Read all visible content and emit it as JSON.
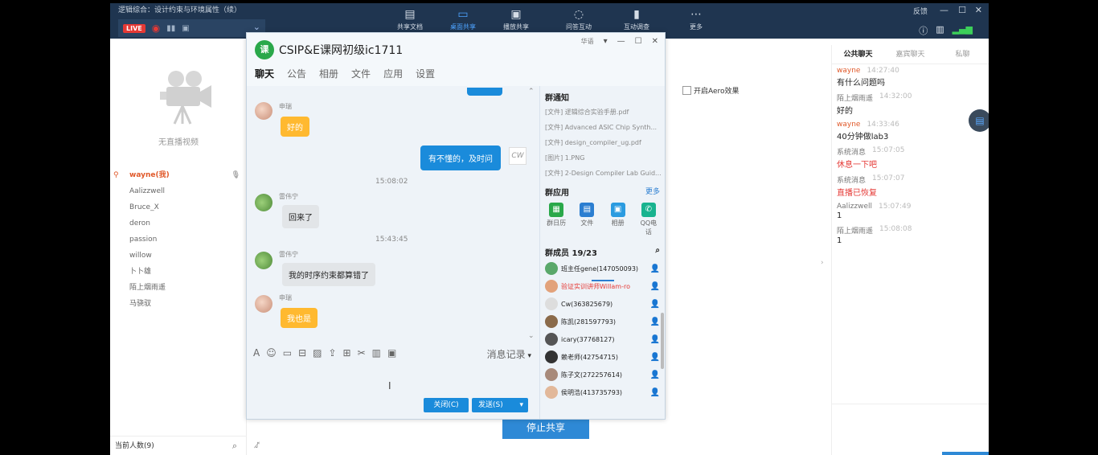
{
  "app": {
    "title": "逻辑综合：设计约束与环境属性（续）",
    "feedback": "反馈",
    "live_label": "LIVE",
    "toolbar": [
      {
        "label": "共享文档",
        "icon": "▤",
        "active": false
      },
      {
        "label": "桌面共享",
        "icon": "▭",
        "active": true
      },
      {
        "label": "播放共享",
        "icon": "▣",
        "active": false
      },
      {
        "label": "问答互动",
        "icon": "◌",
        "active": false
      },
      {
        "label": "互动调查",
        "icon": "▮",
        "active": false
      },
      {
        "label": "更多",
        "icon": "⋯",
        "active": false
      }
    ]
  },
  "left": {
    "no_video": "无直播视频",
    "me": "wayne(我)",
    "members": [
      "Aalizzwell",
      "Bruce_X",
      "deron",
      "passion",
      "willow",
      "卜卜雄",
      "陌上烟雨遥",
      "马骁驭"
    ],
    "count_label": "当前人数(9)"
  },
  "aero_label": "开启Aero效果",
  "stop_share": "停止共享",
  "qq": {
    "title": "CSIP&E课网初级ic1711",
    "lang": "华语",
    "tabs": [
      "聊天",
      "公告",
      "相册",
      "文件",
      "应用",
      "设置"
    ],
    "messages": {
      "m1_sender": "申瑞",
      "m1_text": "好的",
      "m2_text": "有不懂的，及时问",
      "my_avatar": "CW",
      "ts1": "15:08:02",
      "m3_sender": "雷伟宁",
      "m3_text": "回来了",
      "ts2": "15:43:45",
      "m4_sender": "雷伟宁",
      "m4_text": "我的时序约束都算错了",
      "m5_sender": "申瑞",
      "m5_text": "我也是"
    },
    "records_label": "消息记录",
    "close_btn": "关闭(C)",
    "send_btn": "发送(S)",
    "notice_title": "群通知",
    "notices": [
      "[文件] 逻辑综合实验手册.pdf",
      "[文件] Advanced ASIC Chip Synth...",
      "[文件] design_compiler_ug.pdf",
      "[图片] 1.PNG",
      "[文件] 2-Design Compiler Lab Guid..."
    ],
    "apps_title": "群应用",
    "apps_more": "更多",
    "apps": [
      {
        "label": "群日历",
        "icon": "▦",
        "color": "#2aa84a"
      },
      {
        "label": "文件",
        "icon": "▤",
        "color": "#2b7ed1"
      },
      {
        "label": "相册",
        "icon": "▣",
        "color": "#2b9be0"
      },
      {
        "label": "QQ电话",
        "icon": "✆",
        "color": "#19b38f"
      }
    ],
    "members_title": "群成员 19/23",
    "members": [
      {
        "name": "班主任gene(147050093)",
        "red": false,
        "color": "#5aa86a"
      },
      {
        "name": "验证实训讲师Willam-ro",
        "red": true,
        "color": "#e2a27a"
      },
      {
        "name": "Cw(363825679)",
        "red": false,
        "color": "#dddddd"
      },
      {
        "name": "陈凯(281597793)",
        "red": false,
        "color": "#8a6a4a"
      },
      {
        "name": "icary(37768127)",
        "red": false,
        "color": "#555555"
      },
      {
        "name": "赖老师(42754715)",
        "red": false,
        "color": "#333333"
      },
      {
        "name": "陈子文(272257614)",
        "red": false,
        "color": "#a88a7a"
      },
      {
        "name": "侯明浩(413735793)",
        "red": false,
        "color": "#e2b89a"
      }
    ]
  },
  "right": {
    "tabs": [
      "公共聊天",
      "嘉宾聊天",
      "私聊"
    ],
    "messages": [
      {
        "name": "wayne",
        "me": true,
        "time": "14:27:40",
        "text": "有什么问题吗",
        "red": false
      },
      {
        "name": "陌上烟雨遥",
        "me": false,
        "time": "14:32:00",
        "text": "好的",
        "red": false
      },
      {
        "name": "wayne",
        "me": true,
        "time": "14:33:46",
        "text": "40分钟做lab3",
        "red": false
      },
      {
        "name": "系统消息",
        "me": false,
        "time": "15:07:05",
        "text": "休息一下吧",
        "red": true
      },
      {
        "name": "系统消息",
        "me": false,
        "time": "15:07:07",
        "text": "直播已恢复",
        "red": true
      },
      {
        "name": "Aalizzwell",
        "me": false,
        "time": "15:07:49",
        "text": "1",
        "red": false
      },
      {
        "name": "陌上烟雨遥",
        "me": false,
        "time": "15:08:08",
        "text": "1",
        "red": false
      }
    ]
  }
}
